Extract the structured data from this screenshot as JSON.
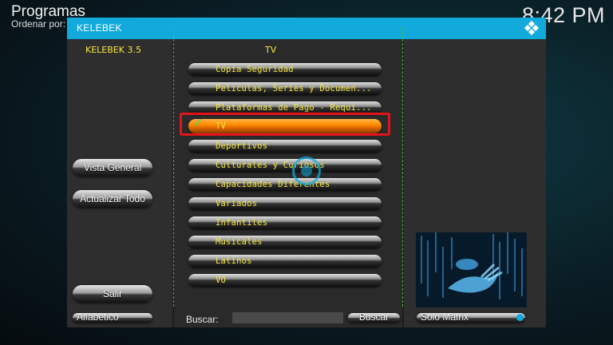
{
  "background": {
    "title": "Programas",
    "sort_label": "Ordenar por:",
    "clock": "8:42 PM"
  },
  "dialog": {
    "title": "KELEBEK",
    "version_label": "KELEBEK 3.5",
    "category_header": "TV",
    "accent_color": "#12aadd",
    "selection_color": "#e3131b",
    "items": [
      {
        "label": "Copia Seguridad"
      },
      {
        "label": "Peliculas, Series y Documen..."
      },
      {
        "label": "Plataformas de Pago - Requi..."
      },
      {
        "label": "TV",
        "selected": true
      },
      {
        "label": "Deportivos"
      },
      {
        "label": "Culturales y Curiosos"
      },
      {
        "label": "Capacidades Diferentes"
      },
      {
        "label": "Variados"
      },
      {
        "label": "Infantiles"
      },
      {
        "label": "Musicales"
      },
      {
        "label": "Latinos"
      },
      {
        "label": "VO"
      }
    ],
    "buttons": {
      "vista_general": "Vista General",
      "actualizar_todo": "Actualizar Todo",
      "salir": "Salir",
      "alfabetico": "Alfabetico",
      "buscar": "Buscar",
      "solo_matrix": "Solo Matrix"
    },
    "search": {
      "label": "Buscar:",
      "value": ""
    }
  }
}
